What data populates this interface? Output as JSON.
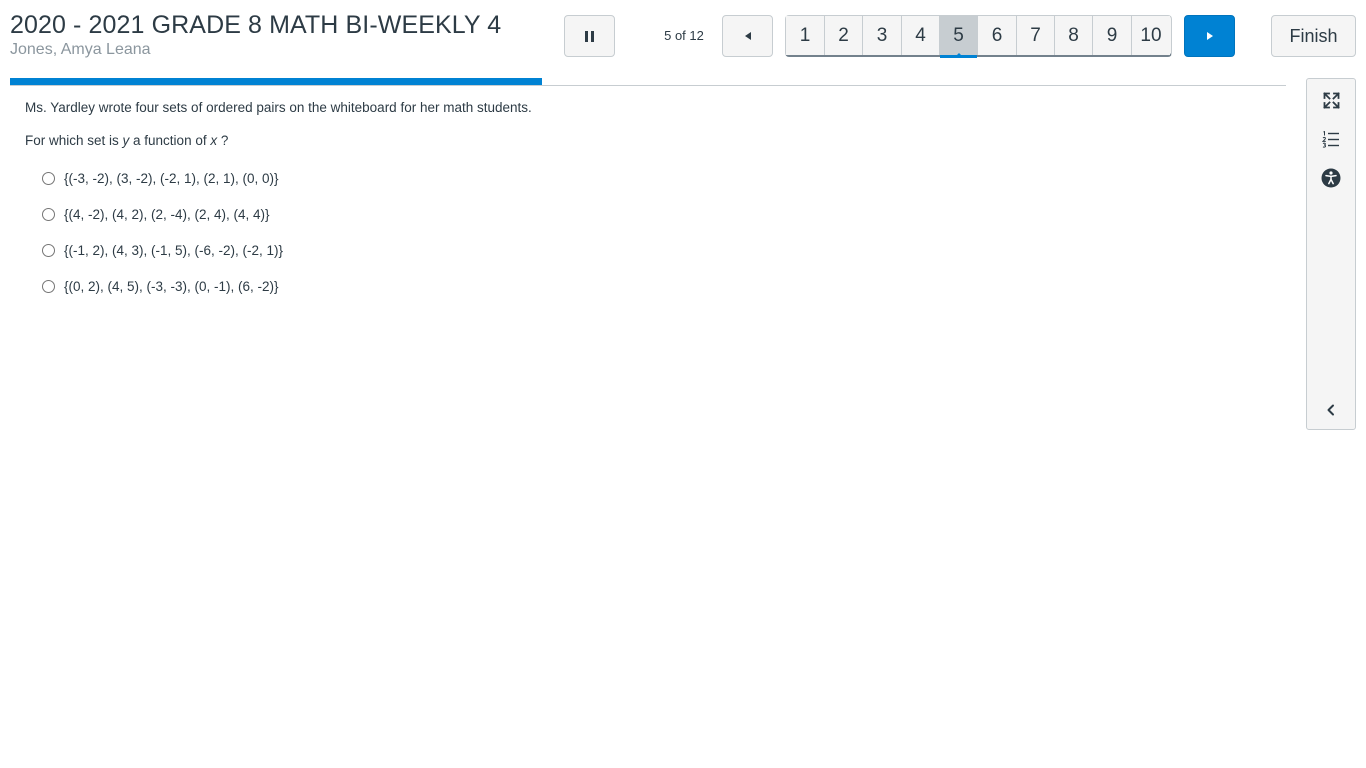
{
  "header": {
    "title": "2020 - 2021 GRADE 8 MATH BI-WEEKLY 4",
    "student": "Jones, Amya Leana",
    "counter": "5 of 12",
    "finish_label": "Finish"
  },
  "pager": {
    "pages": [
      "1",
      "2",
      "3",
      "4",
      "5",
      "6",
      "7",
      "8",
      "9",
      "10"
    ],
    "current": "5"
  },
  "progress": {
    "fraction": 0.417
  },
  "question": {
    "stem_line1": "Ms. Yardley wrote four sets of ordered pairs on the whiteboard for her math students.",
    "stem_line2_prefix": "For which set is ",
    "stem_var_y": "y",
    "stem_line2_mid": " a function of ",
    "stem_var_x": "x",
    "stem_line2_suffix": " ?",
    "choices": [
      "{(-3, -2), (3, -2), (-2, 1), (2, 1), (0, 0)}",
      "{(4, -2), (4, 2), (2, -4), (2, 4), (4, 4)}",
      "{(-1, 2), (4, 3), (-1, 5), (-6, -2), (-2, 1)}",
      "{(0, 2), (4, 5), (-3, -3), (0, -1), (6, -2)}"
    ]
  },
  "colors": {
    "accent": "#0082d3",
    "text": "#2d3b45",
    "muted": "#8b969e",
    "border": "#c7cdd1"
  },
  "icons": {
    "pause": "pause-icon",
    "previous": "triangle-left-icon",
    "next": "triangle-right-icon",
    "fullscreen": "expand-icon",
    "outline": "numbered-list-icon",
    "accessibility": "accessibility-icon",
    "collapse": "chevron-left-icon"
  }
}
